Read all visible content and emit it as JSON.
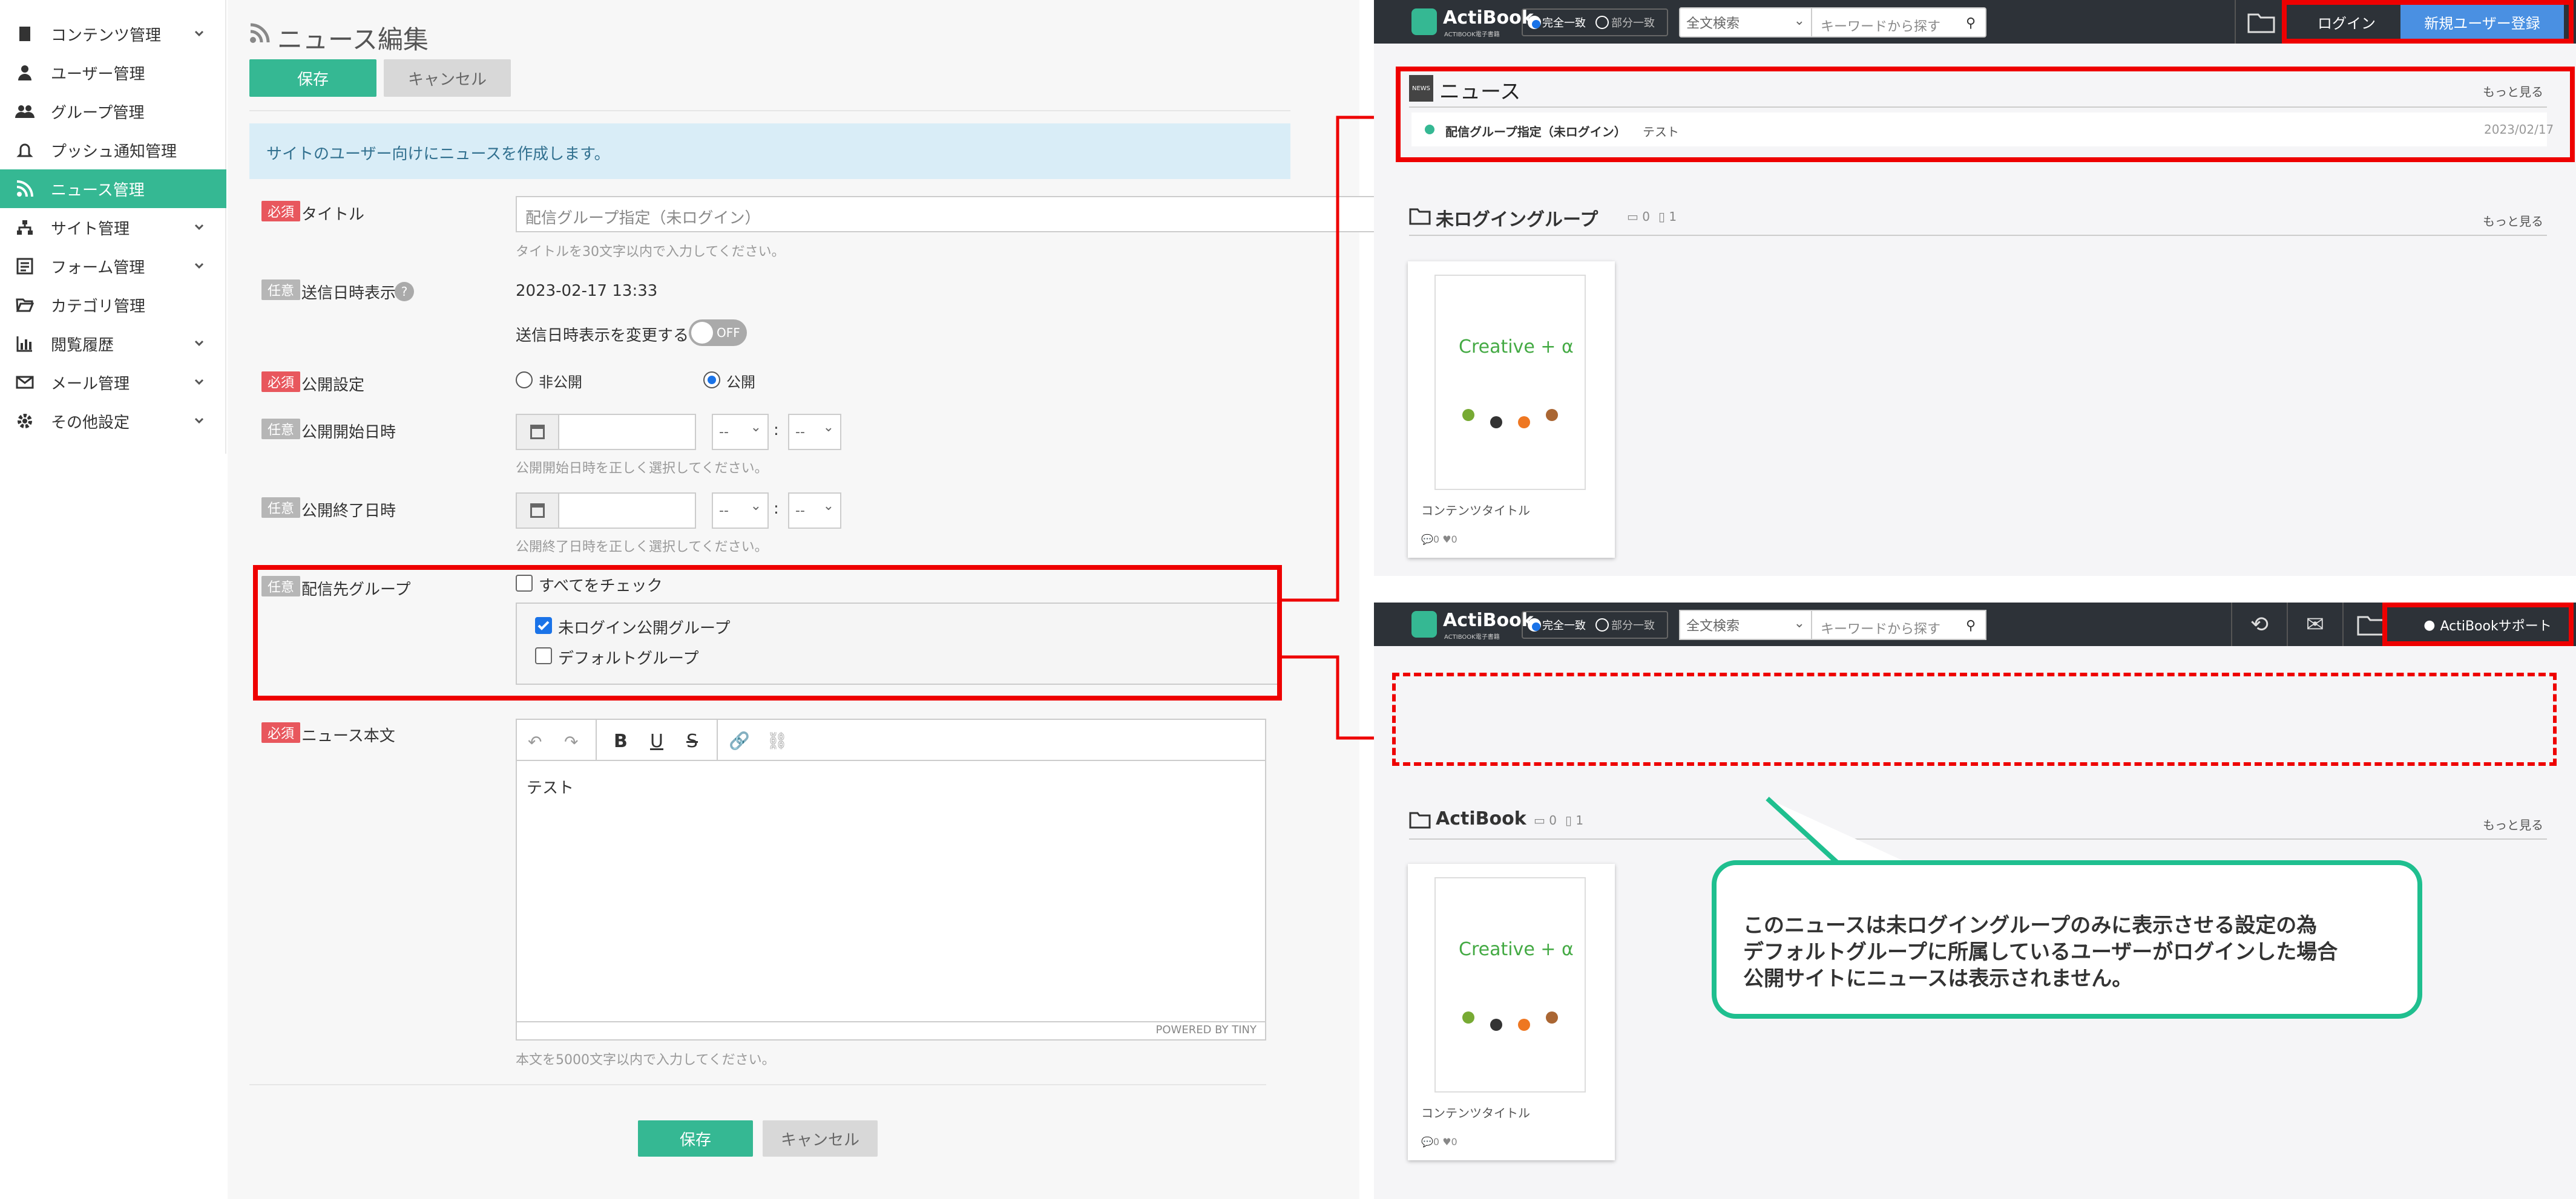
{
  "sidebar": {
    "items": [
      {
        "label": "コンテンツ管理",
        "icon": "document-icon",
        "chevron": true
      },
      {
        "label": "ユーザー管理",
        "icon": "user-icon",
        "chevron": false
      },
      {
        "label": "グループ管理",
        "icon": "users-icon",
        "chevron": false
      },
      {
        "label": "プッシュ通知管理",
        "icon": "bell-icon",
        "chevron": false
      },
      {
        "label": "ニュース管理",
        "icon": "rss-icon",
        "chevron": false,
        "active": true
      },
      {
        "label": "サイト管理",
        "icon": "sitemap-icon",
        "chevron": true
      },
      {
        "label": "フォーム管理",
        "icon": "form-icon",
        "chevron": true
      },
      {
        "label": "カテゴリ管理",
        "icon": "folder-open-icon",
        "chevron": false
      },
      {
        "label": "閲覧履歴",
        "icon": "bar-chart-icon",
        "chevron": true
      },
      {
        "label": "メール管理",
        "icon": "mail-icon",
        "chevron": true
      },
      {
        "label": "その他設定",
        "icon": "gear-icon",
        "chevron": true
      }
    ]
  },
  "editor_page": {
    "title": "ニュース編集",
    "save_label": "保存",
    "cancel_label": "キャンセル",
    "info_text": "サイトのユーザー向けにニュースを作成します。",
    "required_badge": "必須",
    "optional_badge": "任意",
    "fields": {
      "title": {
        "label": "タイトル",
        "value": "配信グループ指定（未ログイン）",
        "help": "タイトルを30文字以内で入力してください。"
      },
      "send_datetime": {
        "label": "送信日時表示",
        "value": "2023-02-17 13:33",
        "change_label": "送信日時表示を変更する",
        "toggle": "OFF"
      },
      "publish": {
        "label": "公開設定",
        "option_private": "非公開",
        "option_public": "公開",
        "selected": "公開"
      },
      "publish_start": {
        "label": "公開開始日時",
        "hour_placeholder": "--",
        "minute_placeholder": "--",
        "separator": ":",
        "help": "公開開始日時を正しく選択してください。"
      },
      "publish_end": {
        "label": "公開終了日時",
        "hour_placeholder": "--",
        "minute_placeholder": "--",
        "separator": ":",
        "help": "公開終了日時を正しく選択してください。"
      },
      "groups": {
        "label": "配信先グループ",
        "check_all": "すべてをチェック",
        "items": [
          {
            "label": "未ログイン公開グループ",
            "checked": true
          },
          {
            "label": "デフォルトグループ",
            "checked": false
          }
        ]
      },
      "body": {
        "label": "ニュース本文",
        "content": "テスト",
        "powered_by": "POWERED BY TINY",
        "help": "本文を5000文字以内で入力してください。"
      }
    }
  },
  "site_top": {
    "brand": "ActiBook",
    "brand_sub": "ACTIBOOK電子書籍",
    "match_exact": "完全一致",
    "match_partial": "部分一致",
    "search_scope": "全文検索",
    "search_placeholder": "キーワードから探す",
    "login_label": "ログイン",
    "register_label": "新規ユーザー登録",
    "news_icon_text": "NEWS",
    "news_heading": "ニュース",
    "more_label": "もっと見る",
    "news_item": {
      "title": "配信グループ指定（未ログイン）",
      "body": "テスト",
      "date": "2023/02/17"
    },
    "group_name": "未ログイングループ",
    "folder_count": "0",
    "file_count": "1",
    "content_title": "コンテンツタイトル",
    "comment_count": "0",
    "like_count": "0",
    "cover_text": "Creative + α"
  },
  "site_bottom": {
    "brand": "ActiBook",
    "brand_sub": "ACTIBOOK電子書籍",
    "match_exact": "完全一致",
    "match_partial": "部分一致",
    "search_scope": "全文検索",
    "search_placeholder": "キーワードから探す",
    "user_label": "ActiBookサポート",
    "group_name": "ActiBook",
    "folder_count": "0",
    "file_count": "1",
    "more_label": "もっと見る",
    "content_title": "コンテンツタイトル",
    "comment_count": "0",
    "like_count": "0",
    "cover_text": "Creative + α"
  },
  "callout": {
    "lines": [
      "このニュースは未ログイングループのみに表示させる設定の為",
      "デフォルトグループに所属しているユーザーがログインした場合",
      "公開サイトにニュースは表示されません。"
    ]
  },
  "colors": {
    "accent": "#35b893",
    "highlight": "#e00000",
    "callout_border": "#1fbf8f",
    "topbar": "#2d3238"
  }
}
